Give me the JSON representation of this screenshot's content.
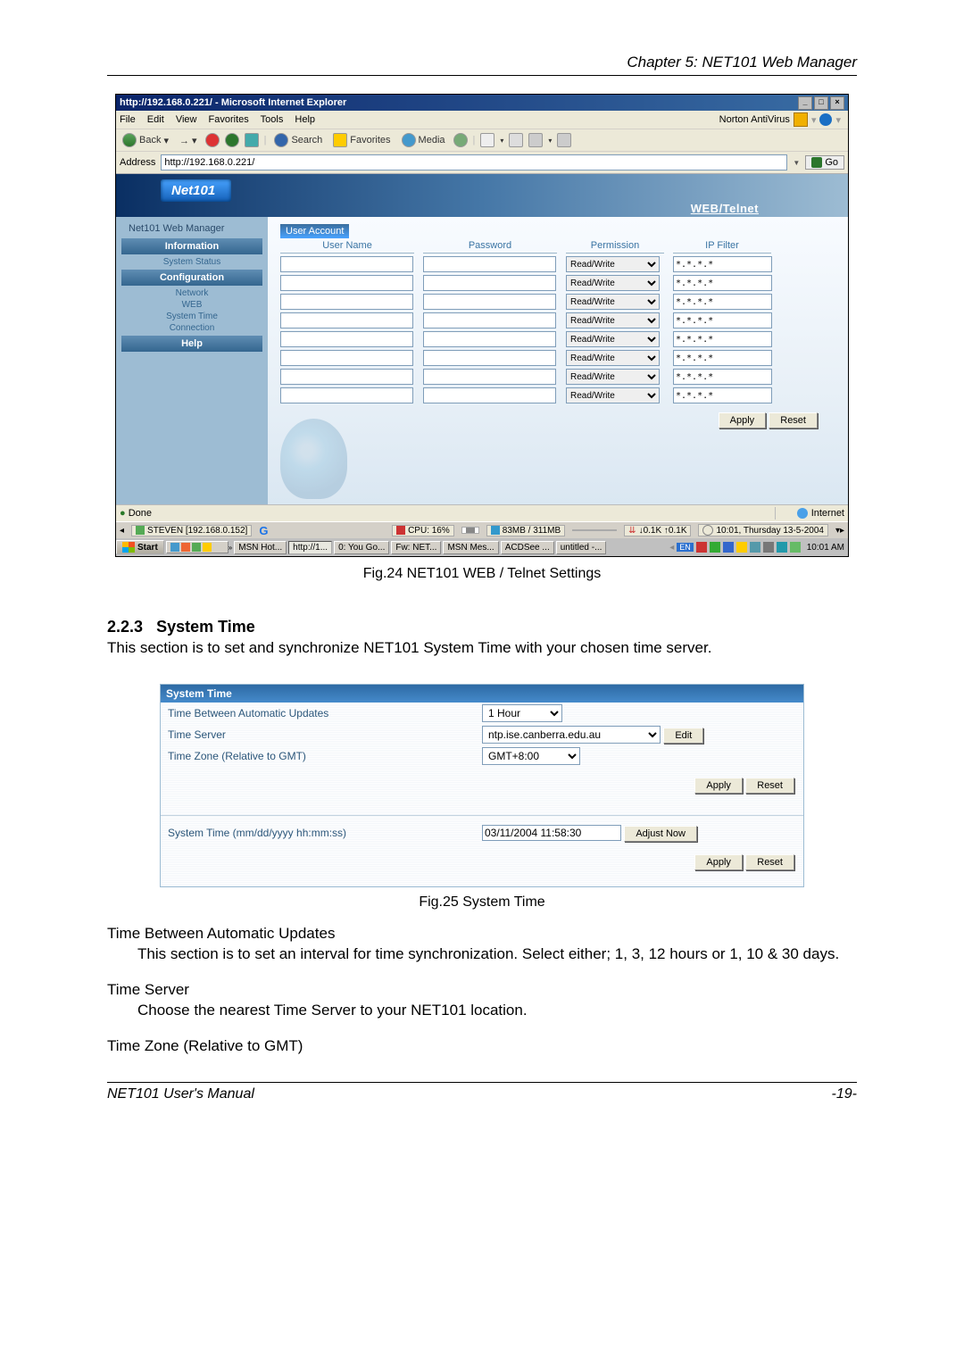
{
  "chapter": "Chapter 5: NET101 Web Manager",
  "ie": {
    "title": "http://192.168.0.221/ - Microsoft Internet Explorer",
    "menus": [
      "File",
      "Edit",
      "View",
      "Favorites",
      "Tools",
      "Help"
    ],
    "norton": "Norton AntiVirus",
    "toolbar": {
      "back": "Back",
      "search": "Search",
      "favorites": "Favorites",
      "media": "Media"
    },
    "address_label": "Address",
    "address_value": "http://192.168.0.221/",
    "go": "Go",
    "status_done": "Done",
    "status_internet": "Internet"
  },
  "page": {
    "product": "Net101",
    "tabs": "WEB/Telnet",
    "sidebar": {
      "header": "Net101 Web Manager",
      "sections": {
        "information": "Information",
        "configuration": "Configuration",
        "help": "Help"
      },
      "items": {
        "system_status": "System Status",
        "network": "Network",
        "web": "WEB",
        "system_time": "System Time",
        "connection": "Connection"
      }
    },
    "user_account": {
      "title": "User Account",
      "cols": [
        "User Name",
        "Password",
        "Permission",
        "IP Filter"
      ],
      "permission_value": "Read/Write",
      "ip_filter_value": "*.*.*.*",
      "apply": "Apply",
      "reset": "Reset",
      "row_count": 8
    }
  },
  "taskbar1": {
    "steven": "STEVEN [192.168.0.152]",
    "cpu": "CPU: 16%",
    "mem": "83MB / 311MB",
    "net": "↓0.1K  ↑0.1K",
    "clock": "10:01, Thursday 13-5-2004"
  },
  "taskbar2": {
    "start": "Start",
    "buttons": [
      "MSN Hot...",
      "http://1...",
      "0: You Go...",
      "Fw: NET...",
      "MSN Mes...",
      "ACDSee ...",
      "untitled -..."
    ],
    "lang": "EN",
    "time": "10:01 AM"
  },
  "fig24": "Fig.24  NET101 WEB / Telnet Settings",
  "section": {
    "num": "2.2.3",
    "title": "System Time",
    "text": "This section is to set and synchronize NET101 System Time with your chosen time server."
  },
  "syspanel": {
    "title": "System Time",
    "rows": {
      "tbau": "Time Between Automatic Updates",
      "tbau_val": "1 Hour",
      "tserver": "Time Server",
      "tserver_val": "ntp.ise.canberra.edu.au",
      "edit": "Edit",
      "tz": "Time Zone (Relative to GMT)",
      "tz_val": "GMT+8:00",
      "systime": "System Time (mm/dd/yyyy hh:mm:ss)",
      "systime_val": "03/11/2004 11:58:30",
      "adjust": "Adjust Now",
      "apply": "Apply",
      "reset": "Reset"
    }
  },
  "fig25": "Fig.25  System Time",
  "desc": {
    "tbau_h": "Time Between Automatic Updates",
    "tbau_t": "This section is to set an interval for time synchronization.    Select either; 1, 3, 12 hours or 1, 10 & 30 days.",
    "tserver_h": "Time Server",
    "tserver_t": "Choose the nearest Time Server to your NET101 location.",
    "tz_h": "Time Zone (Relative to GMT)"
  },
  "footer": {
    "left": "NET101  User's  Manual",
    "right": "-19-"
  }
}
